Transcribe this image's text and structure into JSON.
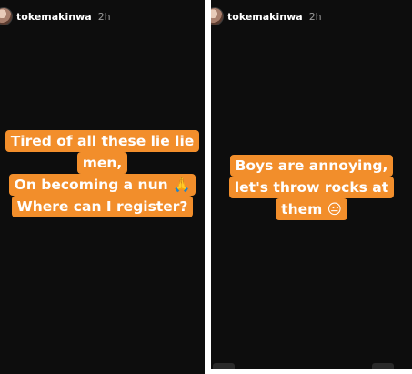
{
  "left_story": {
    "username": "tokemakinwa",
    "time": "2h",
    "lines": [
      "Tired of all these lie lie",
      "men,",
      "On becoming a nun 🙏",
      "Where can I register?"
    ]
  },
  "right_story": {
    "username": "tokemakinwa",
    "time": "2h",
    "lines": [
      "Boys are annoying,",
      "let's throw rocks at",
      "them 😒"
    ]
  },
  "colors": {
    "background": "#0d0d0d",
    "caption_highlight": "#f28e2b",
    "caption_text": "#ffffff"
  },
  "icons": {
    "avatar": "profile-avatar",
    "emoji_left": "praying-hands-emoji",
    "emoji_right": "unamused-face-emoji"
  }
}
